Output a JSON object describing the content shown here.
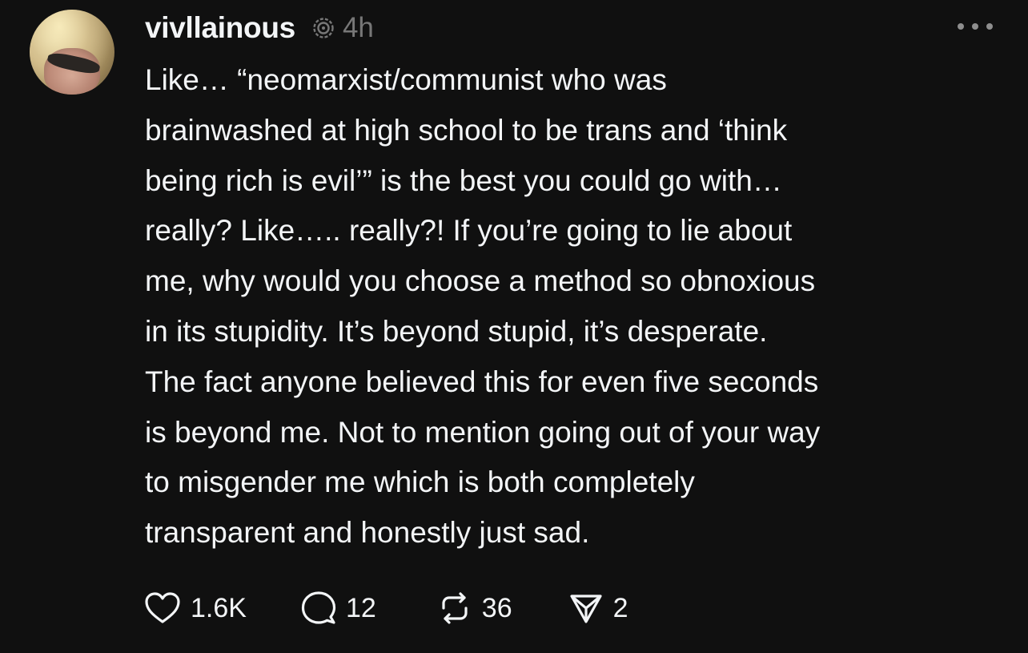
{
  "post": {
    "username": "vivllainous",
    "time": "4h",
    "icons": {
      "thread": "threads-icon",
      "more": "more-dots-icon",
      "like": "heart-icon",
      "reply": "comment-icon",
      "repost": "repost-icon",
      "share": "send-icon"
    },
    "text_lines": [
      "Like… “neomarxist/communist who was",
      "brainwashed at high school to be trans and ‘think",
      "being rich is evil’” is the best you could go with…",
      "really? Like….. really?! If you’re going to lie about",
      "me, why would you choose a method so obnoxious",
      "in its stupidity. It’s beyond stupid, it’s desperate.",
      "The fact anyone believed this for even five seconds",
      "is beyond me. Not to mention going out of your way",
      "to misgender me which is both completely",
      "transparent and honestly just sad."
    ],
    "stats": {
      "likes": "1.6K",
      "replies": "12",
      "reposts": "36",
      "shares": "2"
    }
  },
  "colors": {
    "background": "#101010",
    "text": "#f3f5f7",
    "muted": "#777777"
  }
}
